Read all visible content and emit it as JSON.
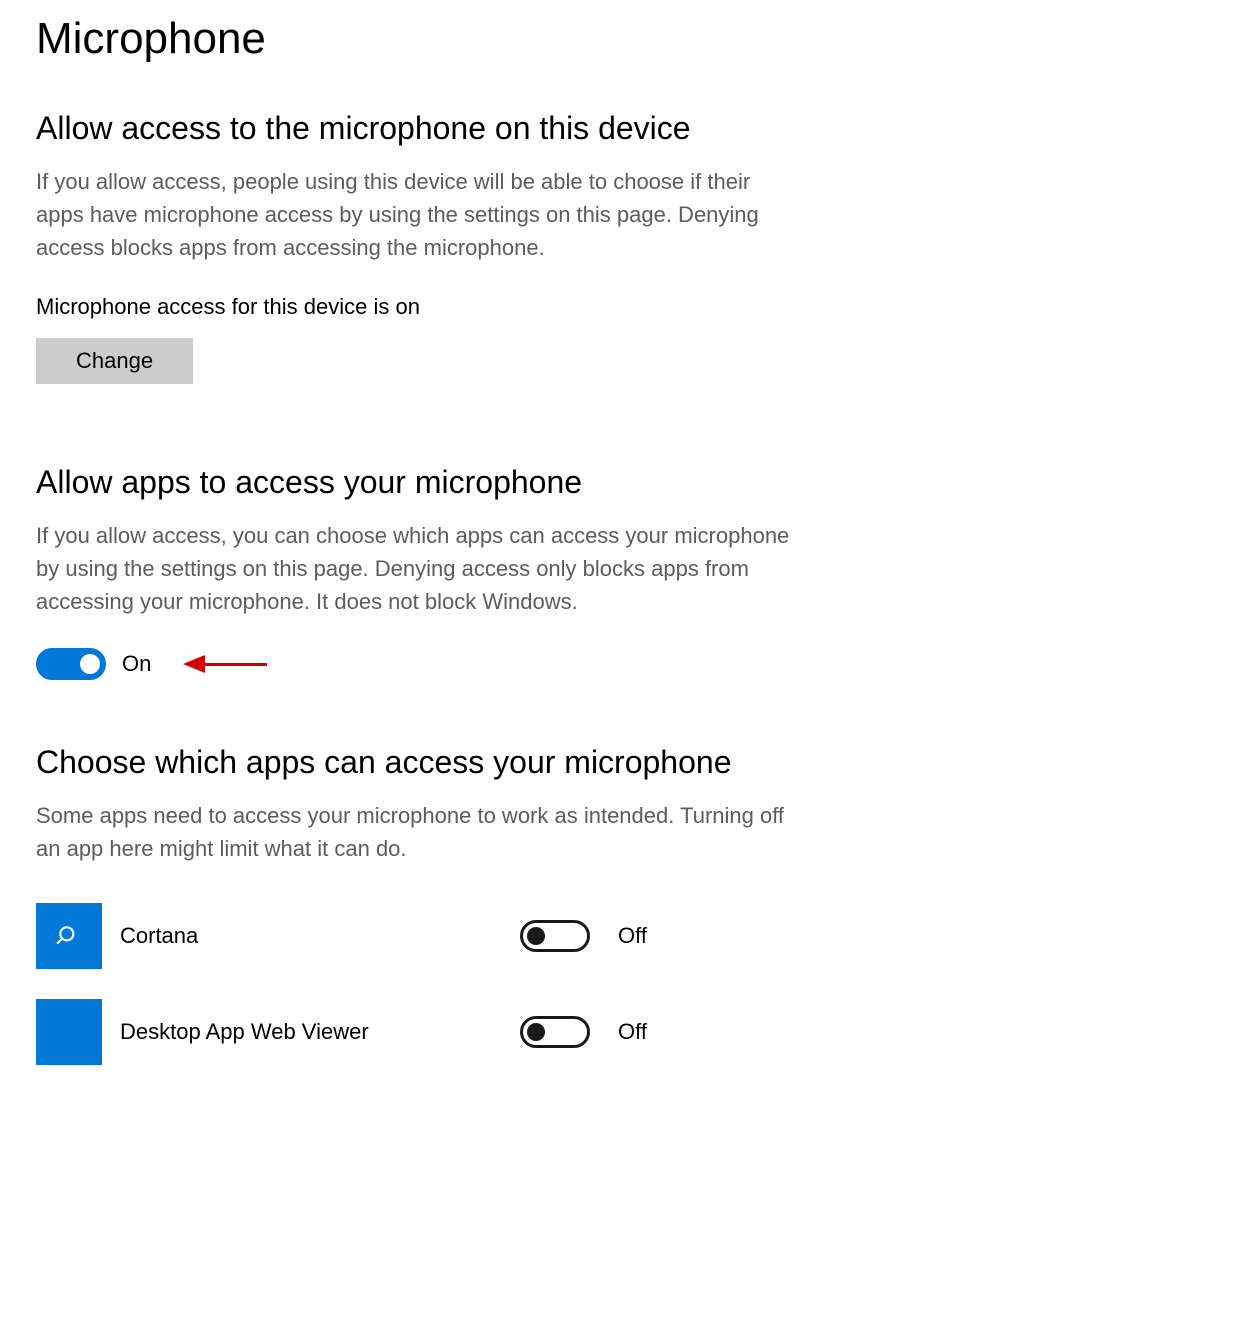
{
  "page_title": "Microphone",
  "section1": {
    "heading": "Allow access to the microphone on this device",
    "desc": "If you allow access, people using this device will be able to choose if their apps have microphone access by using the settings on this page. Denying access blocks apps from accessing the microphone.",
    "status": "Microphone access for this device is on",
    "change_label": "Change"
  },
  "section2": {
    "heading": "Allow apps to access your microphone",
    "desc": "If you allow access, you can choose which apps can access your microphone by using the settings on this page. Denying access only blocks apps from accessing your microphone. It does not block Windows.",
    "toggle_label": "On"
  },
  "section3": {
    "heading": "Choose which apps can access your microphone",
    "desc": "Some apps need to access your microphone to work as intended. Turning off an app here might limit what it can do.",
    "apps": [
      {
        "name": "Cortana",
        "state_label": "Off"
      },
      {
        "name": "Desktop App Web Viewer",
        "state_label": "Off"
      }
    ]
  }
}
